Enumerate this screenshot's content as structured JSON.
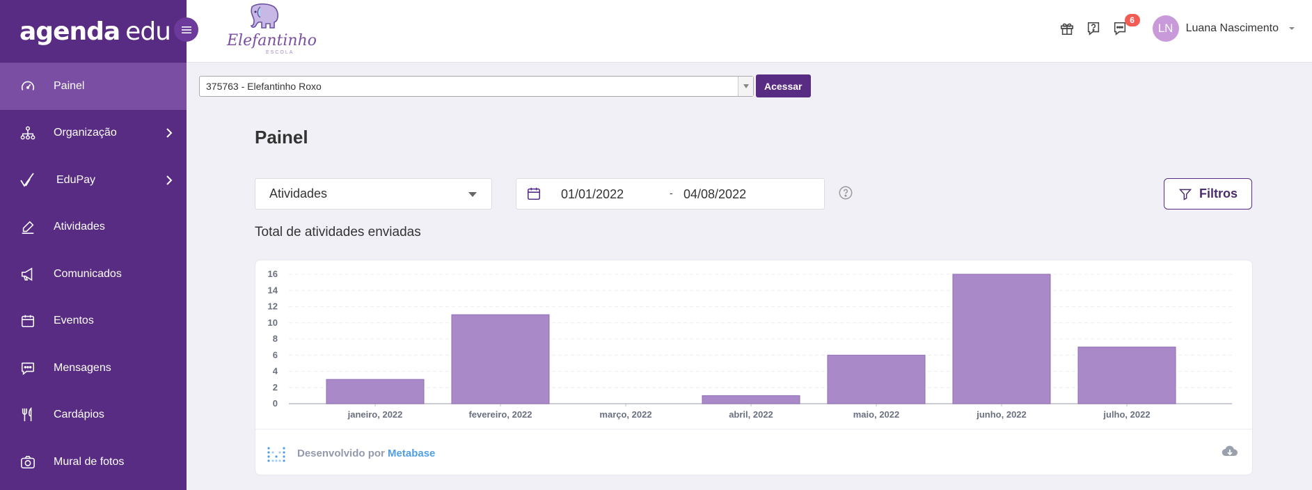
{
  "brand": {
    "part1": "agenda",
    "part2": "edu"
  },
  "school": {
    "logo_word": "Elefantinho",
    "logo_sub": "ESCOLA"
  },
  "sidebar": {
    "items": [
      {
        "label": "Painel"
      },
      {
        "label": "Organização"
      },
      {
        "label": "EduPay"
      },
      {
        "label": "Atividades"
      },
      {
        "label": "Comunicados"
      },
      {
        "label": "Eventos"
      },
      {
        "label": "Mensagens"
      },
      {
        "label": "Cardápios"
      },
      {
        "label": "Mural de fotos"
      }
    ]
  },
  "header": {
    "notification_count": "6",
    "user": {
      "initials": "LN",
      "name": "Luana Nascimento"
    }
  },
  "account": {
    "selected": "375763 - Elefantinho Roxo",
    "button": "Acessar"
  },
  "main": {
    "title": "Painel",
    "report_select": "Atividades",
    "date_from": "01/01/2022",
    "date_separator": "-",
    "date_to": "04/08/2022",
    "filters_button": "Filtros",
    "chart_heading": "Total de atividades enviadas"
  },
  "chart_data": {
    "type": "bar",
    "categories": [
      "janeiro, 2022",
      "fevereiro, 2022",
      "março, 2022",
      "abril, 2022",
      "maio, 2022",
      "junho, 2022",
      "julho, 2022"
    ],
    "values": [
      3,
      11,
      0,
      1,
      6,
      16,
      7
    ],
    "ylim": [
      0,
      16
    ],
    "yticks": [
      0,
      2,
      4,
      6,
      8,
      10,
      12,
      14,
      16
    ],
    "grid": true,
    "bar_color": "#a989c8"
  },
  "footer": {
    "prefix": "Desenvolvido por",
    "link": "Metabase"
  },
  "colors": {
    "primary": "#582c83",
    "sidebar_active": "#7a4fa3",
    "badge": "#f25c54",
    "avatar": "#c99ad9"
  }
}
